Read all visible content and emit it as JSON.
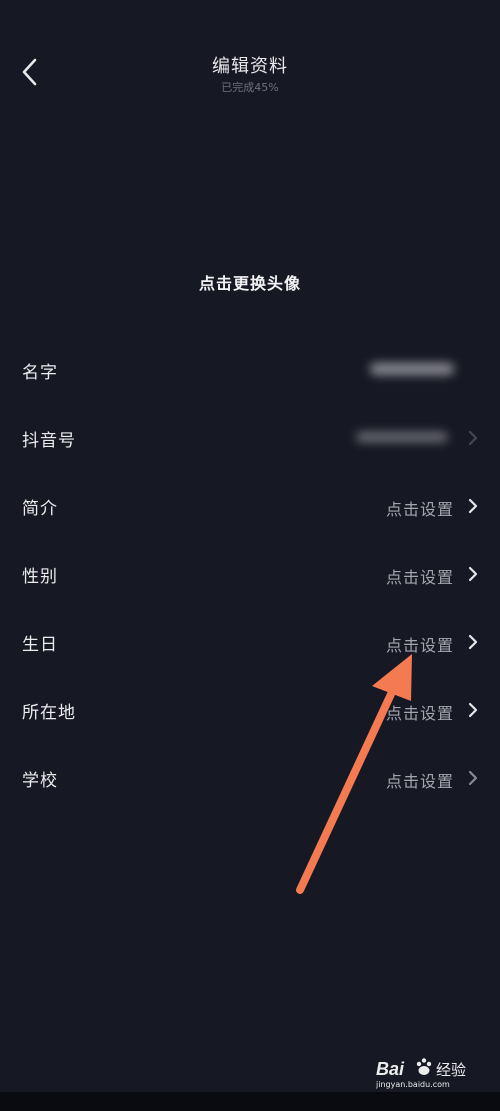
{
  "header": {
    "title": "编辑资料",
    "subtitle": "已完成45%"
  },
  "avatar": {
    "label": "点击更换头像"
  },
  "rows": [
    {
      "label": "名字",
      "value": "",
      "blurred": true,
      "chevron": false
    },
    {
      "label": "抖音号",
      "value": "",
      "blurred": true,
      "chevron": true
    },
    {
      "label": "简介",
      "value": "点击设置",
      "blurred": false,
      "chevron": true
    },
    {
      "label": "性别",
      "value": "点击设置",
      "blurred": false,
      "chevron": true
    },
    {
      "label": "生日",
      "value": "点击设置",
      "blurred": false,
      "chevron": true
    },
    {
      "label": "所在地",
      "value": "点击设置",
      "blurred": false,
      "chevron": true
    },
    {
      "label": "学校",
      "value": "点击设置",
      "blurred": false,
      "chevron": true
    }
  ],
  "icons": {
    "back": "chevron-left-icon",
    "row_arrow": "chevron-right-icon"
  },
  "colors": {
    "background": "#161823",
    "annotation_arrow": "#f47a52"
  },
  "watermark": {
    "brand": "Bai",
    "brand_suffix": "经验",
    "site": "jingyan.baidu.com"
  }
}
